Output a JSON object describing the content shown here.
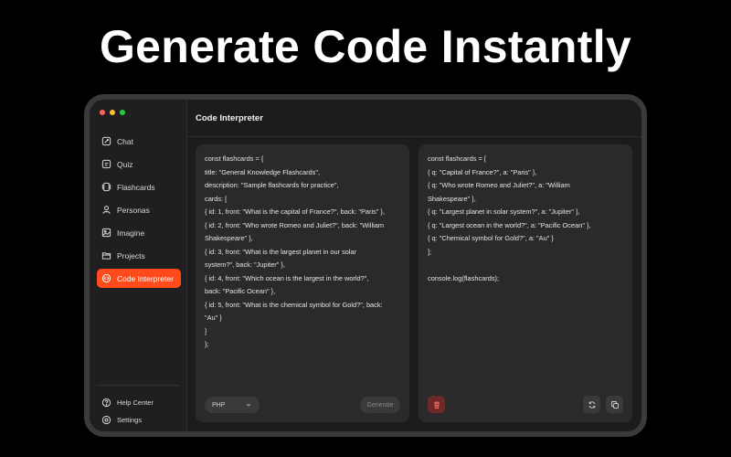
{
  "headline": "Generate Code Instantly",
  "colors": {
    "accent": "#ff4a1c",
    "traffic_red": "#ff5f57",
    "traffic_yellow": "#febc2e",
    "traffic_green": "#28c840",
    "trash_bg": "#6b2a28"
  },
  "sidebar": {
    "items": [
      {
        "label": "Chat",
        "icon": "chat-icon"
      },
      {
        "label": "Quiz",
        "icon": "quiz-icon"
      },
      {
        "label": "Flashcards",
        "icon": "flashcards-icon"
      },
      {
        "label": "Personas",
        "icon": "persona-icon"
      },
      {
        "label": "Imagine",
        "icon": "image-icon"
      },
      {
        "label": "Projects",
        "icon": "folder-icon"
      },
      {
        "label": "Code Interpreter",
        "icon": "code-icon",
        "active": true
      }
    ],
    "bottom": [
      {
        "label": "Help Center",
        "icon": "help-icon"
      },
      {
        "label": "Settings",
        "icon": "gear-icon"
      }
    ]
  },
  "topbar": {
    "title": "Code Interpreter"
  },
  "input_panel": {
    "lines": [
      "const flashcards = {",
      "title: \"General Knowledge Flashcards\",",
      "description: \"Sample flashcards for practice\",",
      "cards: [",
      "{ id: 1, front: \"What is the capital of France?\", back: \"Paris\" },",
      "{ id: 2, front: \"Who wrote Romeo and Juliet?\", back: \"William",
      "Shakespeare\" },",
      "{ id: 3, front: \"What is the largest planet in our solar",
      "system?\", back: \"Jupiter\" },",
      "{ id: 4, front: \"Which ocean is the largest in the world?\",",
      "back: \"Pacific Ocean\" },",
      "{ id: 5, front: \"What is the chemical symbol for Gold?\", back:",
      "\"Au\" }",
      "]",
      "};"
    ],
    "language": "PHP",
    "generate_label": "Generate"
  },
  "output_panel": {
    "lines": [
      "const flashcards = [",
      "{ q: \"Capital of France?\", a: \"Paris\" },",
      "{ q: \"Who wrote Romeo and Juliet?\", a: \"William",
      "Shakespeare\" },",
      "{ q: \"Largest planet in solar system?\", a: \"Jupiter\" },",
      "{ q: \"Largest ocean in the world?\", a: \"Pacific Ocean\" },",
      "{ q: \"Chemical symbol for Gold?\", a: \"Au\" }",
      "];",
      "",
      "console.log(flashcards);"
    ]
  }
}
